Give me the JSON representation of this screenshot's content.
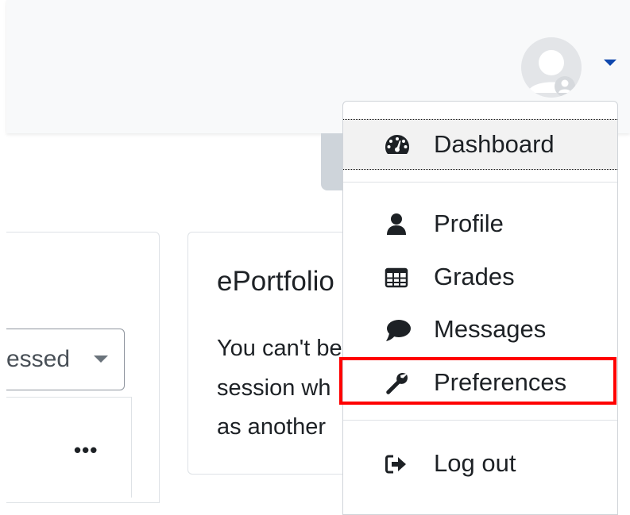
{
  "user_menu": {
    "avatar_icon": "default-user-avatar-icon",
    "caret_icon": "caret-down-icon",
    "accent_color": "#0f47ad",
    "items": [
      {
        "label": "Dashboard",
        "icon": "tachometer-icon"
      },
      {
        "label": "Profile",
        "icon": "user-icon"
      },
      {
        "label": "Grades",
        "icon": "table-icon"
      },
      {
        "label": "Messages",
        "icon": "comment-icon"
      },
      {
        "label": "Preferences",
        "icon": "wrench-icon"
      },
      {
        "label": "Log out",
        "icon": "sign-out-icon"
      }
    ],
    "highlight_color": "#ff0000"
  },
  "left_card": {
    "select_value": "essed",
    "select_icon": "caret-down-icon",
    "more_label": "•••"
  },
  "eportfolio_card": {
    "title": "ePortfolio",
    "lines": [
      "You can't be",
      "session wh",
      "as another"
    ]
  }
}
